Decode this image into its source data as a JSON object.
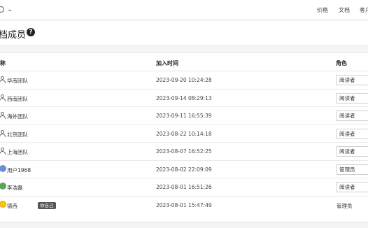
{
  "topbar": {
    "nav": [
      "价格",
      "文档",
      "客户"
    ]
  },
  "header": {
    "title": "档成员",
    "help": "?"
  },
  "table": {
    "columns": {
      "name": "称",
      "joined": "加入时间",
      "role": "角色"
    },
    "rows": [
      {
        "name": "华南团队",
        "joined": "2023-09-20 10:24:28",
        "role": "阅读者",
        "kind": "team"
      },
      {
        "name": "西南团队",
        "joined": "2023-09-14 08:29:13",
        "role": "阅读者",
        "kind": "team"
      },
      {
        "name": "海外团队",
        "joined": "2023-09-11 16:55:39",
        "role": "阅读者",
        "kind": "team"
      },
      {
        "name": "北京团队",
        "joined": "2023-08-22 10:14:18",
        "role": "阅读者",
        "kind": "team"
      },
      {
        "name": "上海团队",
        "joined": "2023-08-07 16:52:25",
        "role": "阅读者",
        "kind": "team"
      },
      {
        "name": "用户1968",
        "joined": "2023-08-02 22:09:09",
        "role": "管理员",
        "kind": "user"
      },
      {
        "name": "李浩磊",
        "joined": "2023-08-01 16:51:26",
        "role": "阅读者",
        "kind": "user"
      },
      {
        "name": "德西",
        "badge": "你自己",
        "joined": "2023-08-01 15:47:49",
        "role": "管理员",
        "kind": "self"
      }
    ]
  },
  "colors": {
    "avatar_user1968": "#6a8fd0",
    "avatar_li": "#5aa35a",
    "avatar_self": "#f5c518"
  }
}
